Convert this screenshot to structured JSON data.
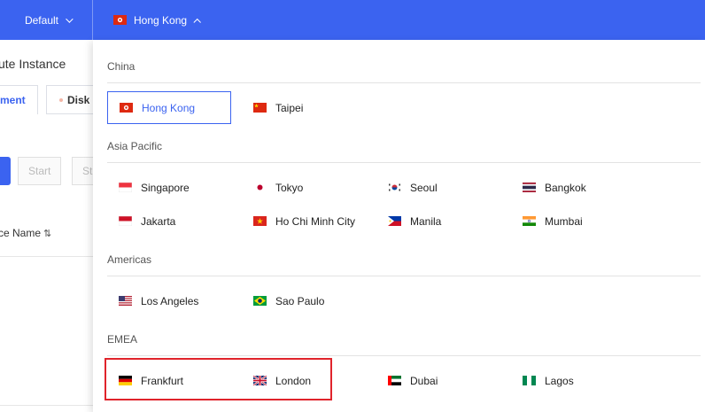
{
  "topbar": {
    "project_label": "Default",
    "region_label": "Hong Kong",
    "accent": "#3b63f0"
  },
  "background": {
    "page_title": "ute Instance",
    "tab_active": "ment",
    "tab_disk": "Disk",
    "btn_start": "Start",
    "btn_stop": "St",
    "col_name": "ce Name"
  },
  "groups": [
    {
      "label": "China",
      "regions": [
        {
          "name": "Hong Kong",
          "flag": "hk-flag-icon",
          "selected": true
        },
        {
          "name": "Taipei",
          "flag": "tw-flag-icon"
        }
      ]
    },
    {
      "label": "Asia Pacific",
      "regions": [
        {
          "name": "Singapore",
          "flag": "sg-flag-icon"
        },
        {
          "name": "Tokyo",
          "flag": "jp-flag-icon"
        },
        {
          "name": "Seoul",
          "flag": "kr-flag-icon"
        },
        {
          "name": "Bangkok",
          "flag": "th-flag-icon"
        },
        {
          "name": "Jakarta",
          "flag": "id-flag-icon"
        },
        {
          "name": "Ho Chi Minh City",
          "flag": "vn-flag-icon"
        },
        {
          "name": "Manila",
          "flag": "ph-flag-icon"
        },
        {
          "name": "Mumbai",
          "flag": "in-flag-icon"
        }
      ]
    },
    {
      "label": "Americas",
      "regions": [
        {
          "name": "Los Angeles",
          "flag": "us-flag-icon"
        },
        {
          "name": "Sao Paulo",
          "flag": "br-flag-icon"
        }
      ]
    },
    {
      "label": "EMEA",
      "regions": [
        {
          "name": "Frankfurt",
          "flag": "de-flag-icon"
        },
        {
          "name": "London",
          "flag": "gb-flag-icon"
        },
        {
          "name": "Dubai",
          "flag": "ae-flag-icon"
        },
        {
          "name": "Lagos",
          "flag": "ng-flag-icon"
        }
      ]
    }
  ]
}
